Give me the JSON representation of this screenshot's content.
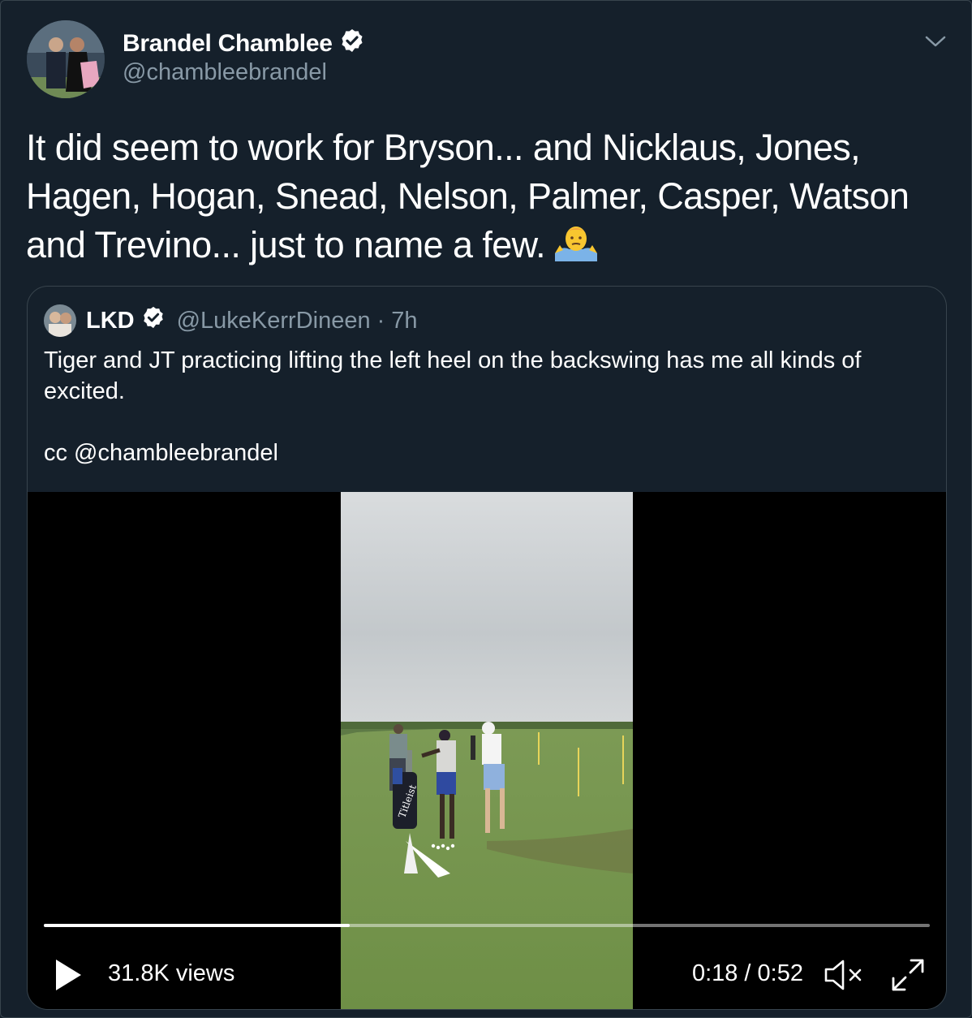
{
  "tweet": {
    "author_name": "Brandel Chamblee",
    "author_handle": "@chambleebrandel",
    "text": "It did seem to work for Bryson... and Nicklaus, Jones, Hagen, Hogan, Snead, Nelson, Palmer, Casper, Watson and Trevino... just to name a few.",
    "emoji_icon": "man-shrugging-emoji-icon"
  },
  "quoted_tweet": {
    "author_name": "LKD",
    "author_handle": "@LukeKerrDineen",
    "separator": "·",
    "time_ago": "7h",
    "text": "Tiger and JT practicing lifting the left heel on the backswing has me all kinds of excited.\n\ncc @chambleebrandel"
  },
  "video": {
    "views": "31.8K views",
    "time": "0:18 / 0:52",
    "progress": 0.345,
    "bag_brand": "Titleist"
  },
  "colors": {
    "background": "#15202b",
    "border": "#38444d",
    "secondary_text": "#8899a6",
    "verified_badge": "#ffffff"
  }
}
